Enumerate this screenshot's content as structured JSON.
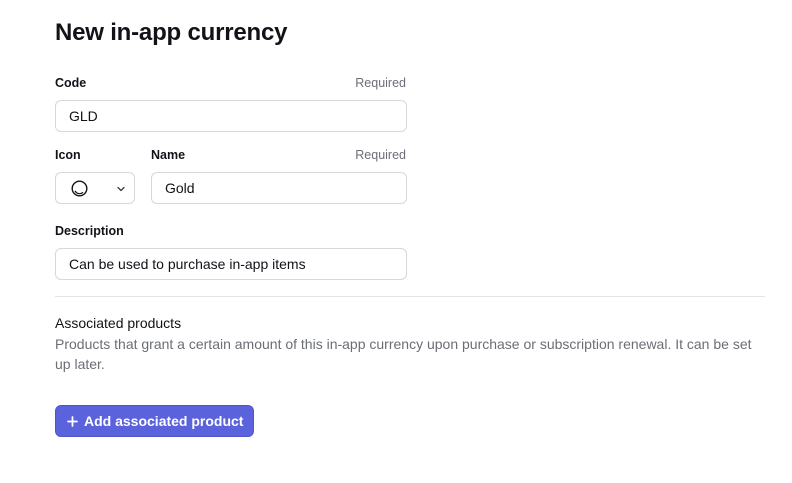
{
  "page": {
    "title": "New in-app currency"
  },
  "form": {
    "code": {
      "label": "Code",
      "required_text": "Required",
      "value": "GLD"
    },
    "icon": {
      "label": "Icon",
      "selected_icon": "coin-icon"
    },
    "name": {
      "label": "Name",
      "required_text": "Required",
      "value": "Gold"
    },
    "description": {
      "label": "Description",
      "value": "Can be used to purchase in-app items"
    }
  },
  "associated_products": {
    "title": "Associated products",
    "description": "Products that grant a certain amount of this in-app currency upon purchase or subscription renewal. It can be set up later.",
    "add_button_label": "Add associated product",
    "add_button_icon": "plus-icon"
  },
  "colors": {
    "accent": "#5b63dc",
    "muted_text": "#6b6e76",
    "border": "#d5d7dc"
  }
}
